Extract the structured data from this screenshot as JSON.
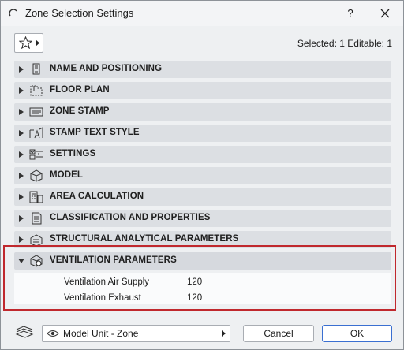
{
  "window": {
    "title": "Zone Selection Settings",
    "help_label": "?"
  },
  "toolbar": {
    "selected_info": "Selected: 1 Editable: 1"
  },
  "panels": [
    {
      "label": "NAME AND POSITIONING",
      "icon": "name-positioning-icon",
      "expanded": false
    },
    {
      "label": "FLOOR PLAN",
      "icon": "floor-plan-icon",
      "expanded": false
    },
    {
      "label": "ZONE STAMP",
      "icon": "zone-stamp-icon",
      "expanded": false
    },
    {
      "label": "STAMP TEXT STYLE",
      "icon": "stamp-text-style-icon",
      "expanded": false
    },
    {
      "label": "SETTINGS",
      "icon": "settings-icon",
      "expanded": false
    },
    {
      "label": "MODEL",
      "icon": "model-icon",
      "expanded": false
    },
    {
      "label": "AREA CALCULATION",
      "icon": "area-calculation-icon",
      "expanded": false
    },
    {
      "label": "CLASSIFICATION AND PROPERTIES",
      "icon": "classification-icon",
      "expanded": false
    },
    {
      "label": "STRUCTURAL ANALYTICAL PARAMETERS",
      "icon": "structural-icon",
      "expanded": false
    },
    {
      "label": "VENTILATION PARAMETERS",
      "icon": "ventilation-icon",
      "expanded": true
    }
  ],
  "ventilation": {
    "rows": [
      {
        "label": "Ventilation Air Supply",
        "value": "120"
      },
      {
        "label": "Ventilation Exhaust",
        "value": "120"
      }
    ]
  },
  "footer": {
    "model_unit_label": "Model Unit - Zone",
    "cancel_label": "Cancel",
    "ok_label": "OK"
  },
  "colors": {
    "highlight": "#c0282d",
    "panel_bg": "#dcdfe3",
    "ok_border": "#3a6fd1"
  }
}
